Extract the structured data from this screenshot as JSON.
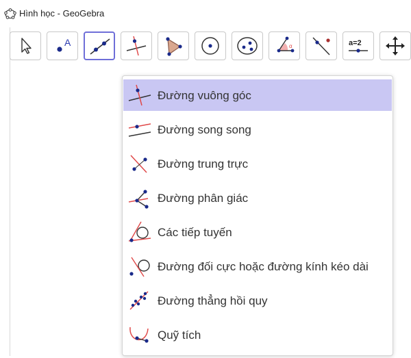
{
  "window": {
    "title": "Hình học - GeoGebra"
  },
  "toolbar": {
    "tools": [
      {
        "name": "move-tool",
        "icon": "arrow-cursor-icon"
      },
      {
        "name": "point-tool",
        "icon": "point-a-icon"
      },
      {
        "name": "line-tool",
        "icon": "line-through-points-icon",
        "active": true
      },
      {
        "name": "perpendicular-tool",
        "icon": "perpendicular-line-icon"
      },
      {
        "name": "polygon-tool",
        "icon": "polygon-icon"
      },
      {
        "name": "circle-tool",
        "icon": "circle-center-icon"
      },
      {
        "name": "conic-tool",
        "icon": "ellipse-icon"
      },
      {
        "name": "angle-tool",
        "icon": "angle-icon"
      },
      {
        "name": "reflect-tool",
        "icon": "reflect-line-icon"
      },
      {
        "name": "slider-tool",
        "icon": "slider-icon",
        "label": "a=2"
      },
      {
        "name": "move-view-tool",
        "icon": "move-graphics-icon"
      }
    ]
  },
  "menu": {
    "items": [
      {
        "label": "Đường vuông góc",
        "icon": "perpendicular-line-icon",
        "selected": true
      },
      {
        "label": "Đường song song",
        "icon": "parallel-line-icon"
      },
      {
        "label": "Đường trung trực",
        "icon": "perpendicular-bisector-icon"
      },
      {
        "label": "Đường phân giác",
        "icon": "angle-bisector-icon"
      },
      {
        "label": "Các tiếp tuyến",
        "icon": "tangents-icon"
      },
      {
        "label": "Đường đối cực hoặc đường kính kéo dài",
        "icon": "polar-line-icon"
      },
      {
        "label": "Đường thẳng hồi quy",
        "icon": "regression-line-icon"
      },
      {
        "label": "Quỹ tích",
        "icon": "locus-icon"
      }
    ]
  },
  "colors": {
    "active_border": "#6e6ed8",
    "selected_row": "#c9c7f3",
    "accent_red": "#e04848",
    "point_blue": "#1a2a8a"
  }
}
